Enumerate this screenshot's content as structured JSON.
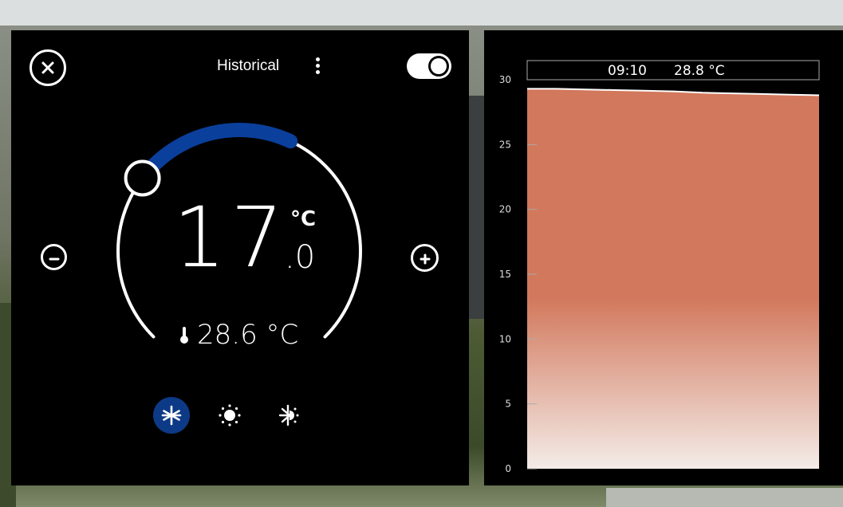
{
  "thermostat": {
    "title": "Historical",
    "setpoint_integer": "17",
    "setpoint_decimal": ".0",
    "setpoint_unit": "°C",
    "current_temperature": "28.6 °C",
    "power_toggle": "on",
    "selected_mode": "cool",
    "colors": {
      "accent": "#0a3f9c",
      "active_mode_bg": "#0d3a87"
    }
  },
  "chart_data": {
    "type": "area",
    "x": [
      0,
      1,
      2,
      3,
      4,
      5,
      6,
      7,
      8,
      9,
      10
    ],
    "y": [
      29.3,
      29.3,
      29.25,
      29.2,
      29.15,
      29.1,
      29.0,
      28.95,
      28.9,
      28.85,
      28.8
    ],
    "ylim": [
      0,
      30
    ],
    "yticks": [
      "0",
      "5",
      "10",
      "15",
      "20",
      "25",
      "30"
    ],
    "tooltip": {
      "time": "09:10",
      "value": "28.8 °C"
    },
    "grid": false,
    "colors": {
      "fill_top": "#d2785c",
      "fill_bottom": "#f4ece8",
      "line": "#ffffff"
    }
  }
}
